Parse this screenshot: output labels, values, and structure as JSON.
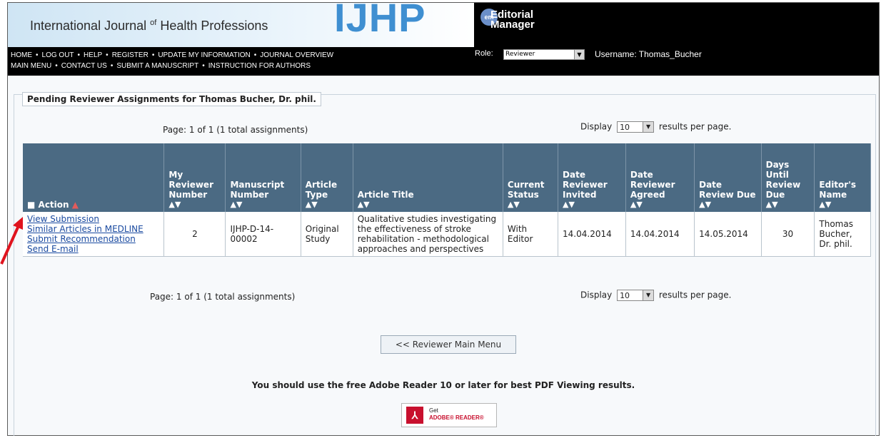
{
  "header": {
    "journal_name_part1": "International Journal",
    "journal_name_of": "of",
    "journal_name_part2": "Health Professions",
    "journal_logo": "IJHP",
    "em_logo_badge": "em",
    "em_logo_line1": "Editorial",
    "em_logo_line2": "Manager",
    "nav_row1": [
      "HOME",
      "LOG OUT",
      "HELP",
      "REGISTER",
      "UPDATE MY INFORMATION",
      "JOURNAL OVERVIEW"
    ],
    "nav_row2": [
      "MAIN MENU",
      "CONTACT US",
      "SUBMIT A MANUSCRIPT",
      "INSTRUCTION FOR AUTHORS"
    ],
    "role_label": "Role:",
    "role_value": "Reviewer",
    "username_text": "Username: Thomas_Bucher"
  },
  "section": {
    "legend": "Pending Reviewer Assignments for Thomas Bucher, Dr. phil."
  },
  "pagination": {
    "page_text": "Page: 1 of 1 (1 total assignments)",
    "display_label": "Display",
    "display_value": "10",
    "display_suffix": "results per page."
  },
  "table": {
    "columns": [
      {
        "label": "Action",
        "prefix": "■",
        "suffix": "▲"
      },
      {
        "label": "My Reviewer Number"
      },
      {
        "label": "Manuscript Number"
      },
      {
        "label": "Article Type"
      },
      {
        "label": "Article Title"
      },
      {
        "label": "Current Status"
      },
      {
        "label": "Date Reviewer Invited"
      },
      {
        "label": "Date Reviewer Agreed"
      },
      {
        "label": "Date Review Due"
      },
      {
        "label": "Days Until Review Due"
      },
      {
        "label": "Editor's Name"
      }
    ],
    "sort_icon": "▲▼",
    "rows": [
      {
        "actions": [
          "View Submission",
          "Similar Articles in MEDLINE",
          "Submit Recommendation",
          "Send E-mail"
        ],
        "reviewer_number": "2",
        "manuscript_number": "IJHP-D-14-00002",
        "article_type": "Original Study",
        "article_title": "Qualitative studies investigating the effectiveness of stroke rehabilitation - methodological approaches and perspectives",
        "current_status": "With Editor",
        "date_invited": "14.04.2014",
        "date_agreed": "14.04.2014",
        "date_due": "14.05.2014",
        "days_until_due": "30",
        "editor_name": "Thomas Bucher, Dr. phil."
      }
    ]
  },
  "buttons": {
    "main_menu": "<< Reviewer Main Menu"
  },
  "notice": {
    "text": "You should use the free Adobe Reader 10 or later for best PDF Viewing results."
  },
  "adobe_badge": {
    "line1": "Get",
    "line2": "ADOBE® READER®"
  },
  "colors": {
    "header_bg": "#000000",
    "table_header_bg": "#4b6a83",
    "link": "#1a4aa0",
    "arrow": "#e0141e"
  }
}
